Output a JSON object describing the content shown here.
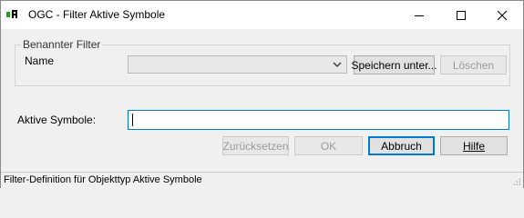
{
  "window": {
    "title": "OGC - Filter Aktive Symbole",
    "icon": "ogc-app-icon",
    "controls": [
      "minimize-icon",
      "maximize-icon",
      "close-icon"
    ]
  },
  "named_filter": {
    "group_title": "Benannter Filter",
    "name_label": "Name",
    "name_value": "",
    "save_label": "Speichern unter...",
    "delete_label": "Löschen"
  },
  "active_symbols": {
    "label": "Aktive Symbole:",
    "value": ""
  },
  "buttons": {
    "reset_label": "Zurücksetzen",
    "ok_label": "OK",
    "cancel_label": "Abbruch",
    "help_label": "Hilfe"
  },
  "status": {
    "text": "Filter-Definition für Objekttyp Aktive Symbole"
  },
  "colors": {
    "focus_accent": "#0078d7",
    "icon_green": "#20a020"
  }
}
